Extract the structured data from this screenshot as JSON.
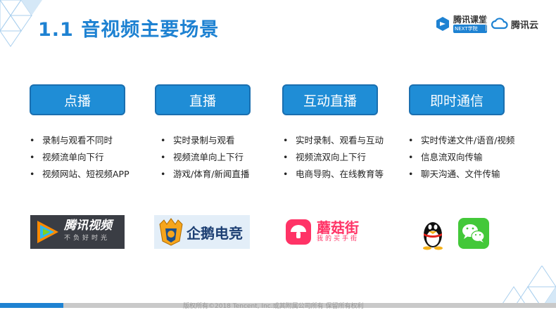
{
  "title": "1.1 音视频主要场景",
  "brand": {
    "classroom_name": "腾讯课堂",
    "classroom_tag": "NEXT学院",
    "cloud_name": "腾讯云"
  },
  "scenarios": [
    {
      "label": "点播",
      "features": [
        "录制与观看不同时",
        "视频流单向下行",
        "视频网站、短视频APP"
      ]
    },
    {
      "label": "直播",
      "features": [
        "实时录制与观看",
        "视频流单向上下行",
        "游戏/体育/新闻直播"
      ]
    },
    {
      "label": "互动直播",
      "features": [
        "实时录制、观看与互动",
        "视频流双向上下行",
        "电商导购、在线教育等"
      ]
    },
    {
      "label": "即时通信",
      "features": [
        "实时传递文件/语音/视频",
        "信息流双向传输",
        "聊天沟通、文件传输"
      ]
    }
  ],
  "logos": {
    "tencent_video": {
      "name": "腾讯视频",
      "slogan": "不负好时光"
    },
    "penguin_esports": {
      "name": "企鹅电竞"
    },
    "mogujie": {
      "name": "蘑菇街",
      "slogan": "我的买手街"
    }
  },
  "footer": {
    "text": "版权所有©2018 Tencent, Inc.或其附属公司所有 保留所有权利"
  },
  "colors": {
    "accent": "#1e82d2",
    "button": "#1f8dd6",
    "mogujie": "#ff3366",
    "wechat": "#43c839"
  }
}
